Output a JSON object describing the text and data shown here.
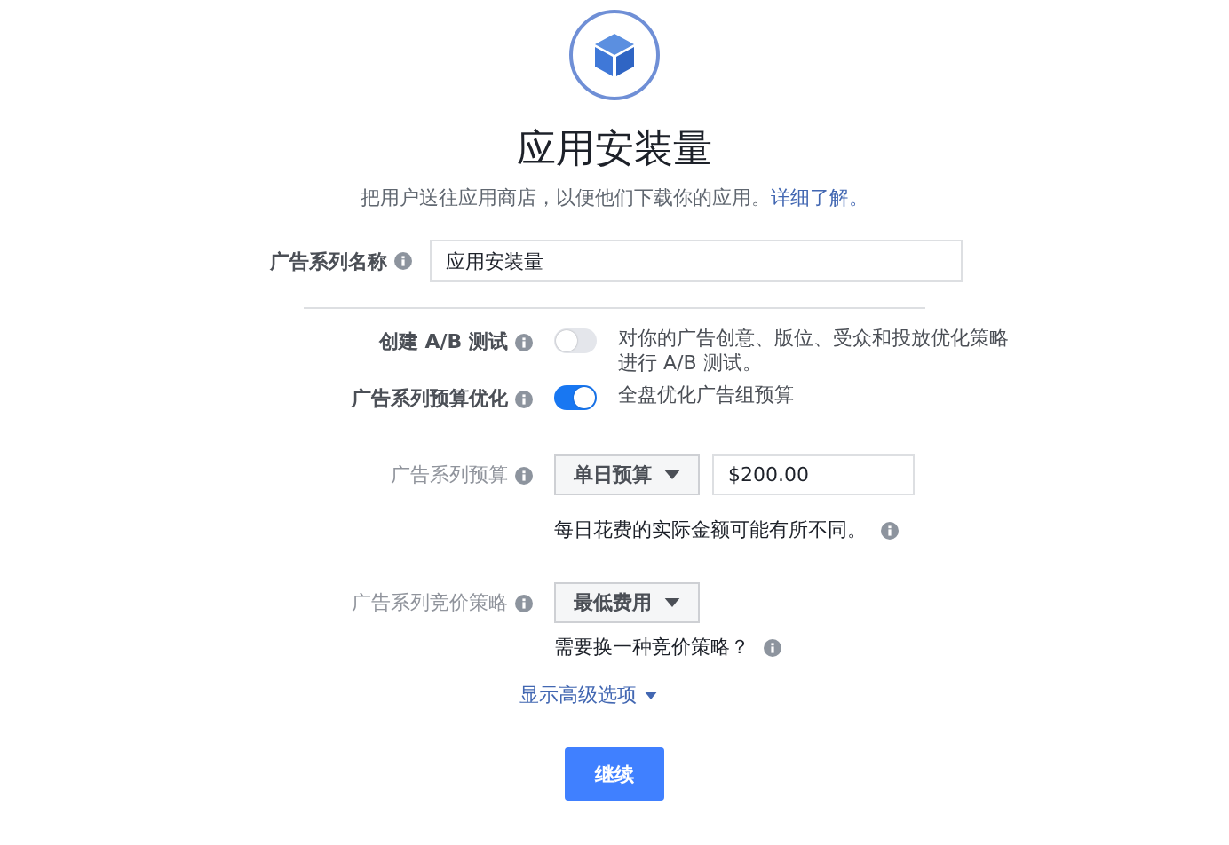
{
  "header": {
    "title": "应用安装量",
    "subtitle": "把用户送往应用商店，以便他们下载你的应用。",
    "link": "详细了解。"
  },
  "name_field": {
    "label": "广告系列名称",
    "value": "应用安装量"
  },
  "toggles": [
    {
      "label": "创建 A/B 测试",
      "on": false,
      "text": "对你的广告创意、版位、受众和投放优化策略进行 A/B 测试。"
    },
    {
      "label": "广告系列预算优化",
      "on": true,
      "text": "全盘优化广告组预算"
    }
  ],
  "budget": {
    "label": "广告系列预算",
    "dropdown": "单日预算",
    "value": "$200.00",
    "note": "每日花费的实际金额可能有所不同。"
  },
  "bid": {
    "label": "广告系列竞价策略",
    "dropdown": "最低费用",
    "note": "需要换一种竞价策略？"
  },
  "advanced_link": "显示高级选项",
  "continue_button": "继续"
}
